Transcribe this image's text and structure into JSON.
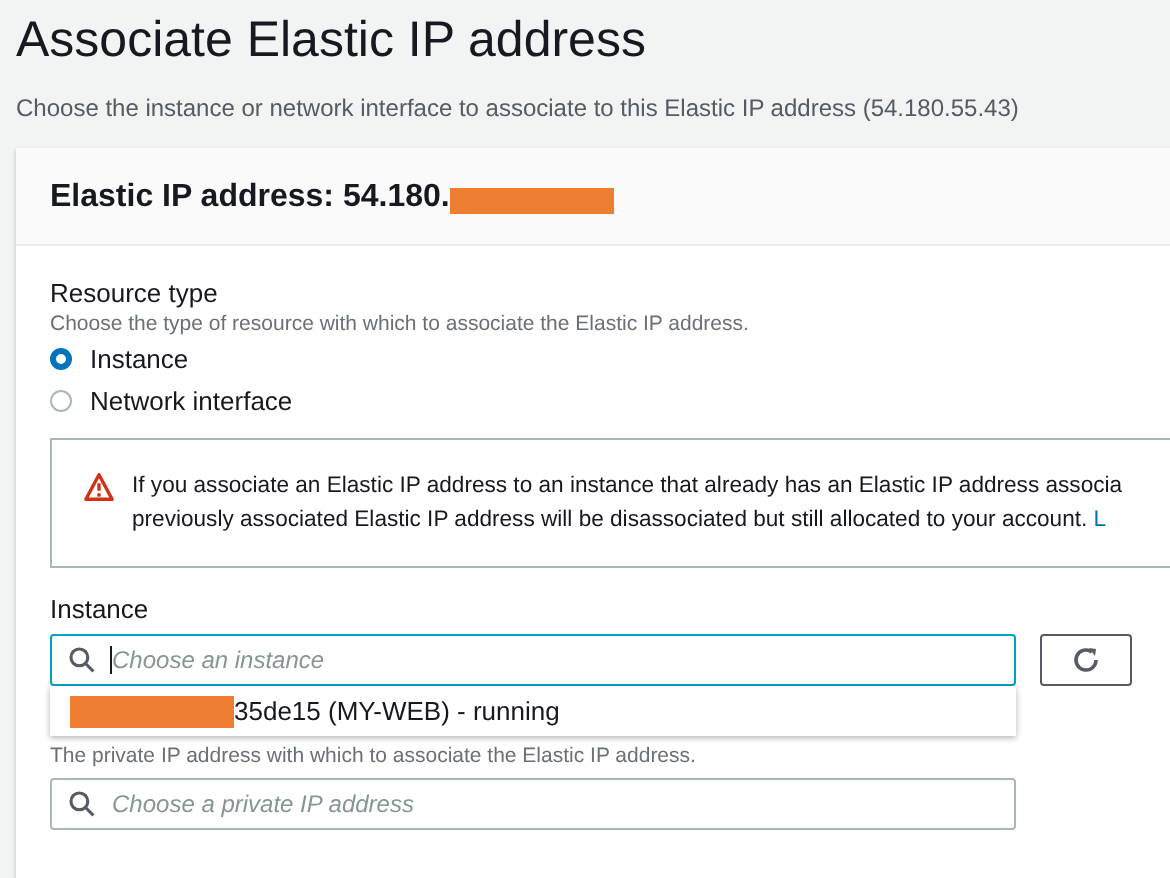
{
  "page": {
    "title": "Associate Elastic IP address",
    "subtitle": "Choose the instance or network interface to associate to this Elastic IP address (54.180.55.43)"
  },
  "card": {
    "heading": "Elastic IP address: 54.180."
  },
  "resource_type": {
    "label": "Resource type",
    "description": "Choose the type of resource with which to associate the Elastic IP address.",
    "options": [
      {
        "label": "Instance",
        "selected": true
      },
      {
        "label": "Network interface",
        "selected": false
      }
    ]
  },
  "alert": {
    "lines": [
      "If you associate an Elastic IP address to an instance that already has an Elastic IP address associa",
      "previously associated Elastic IP address will be disassociated but still allocated to your account."
    ],
    "link": "L"
  },
  "instance": {
    "label": "Instance",
    "placeholder": "Choose an instance",
    "options": [
      {
        "text": "35de15 (MY-WEB) - running"
      }
    ]
  },
  "private_ip": {
    "description": "The private IP address with which to associate the Elastic IP address.",
    "placeholder": "Choose a private IP address"
  }
}
